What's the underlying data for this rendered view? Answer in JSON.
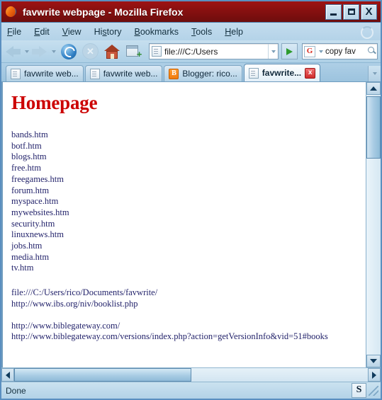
{
  "window": {
    "title": "favwrite webpage - Mozilla Firefox",
    "minimize_label": "Minimize",
    "maximize_label": "Maximize",
    "close_label": "X"
  },
  "menubar": {
    "items": [
      {
        "label": "File",
        "accesskey": "F"
      },
      {
        "label": "Edit",
        "accesskey": "E"
      },
      {
        "label": "View",
        "accesskey": "V"
      },
      {
        "label": "History",
        "accesskey": "s"
      },
      {
        "label": "Bookmarks",
        "accesskey": "B"
      },
      {
        "label": "Tools",
        "accesskey": "T"
      },
      {
        "label": "Help",
        "accesskey": "H"
      }
    ]
  },
  "toolbar": {
    "back_label": "Back",
    "forward_label": "Forward",
    "reload_label": "Reload",
    "stop_label": "Stop",
    "home_label": "Home",
    "newtab_label": "New Tab",
    "address_value": "file:///C:/Users",
    "go_label": "Go",
    "search_engine": "G",
    "search_value": "copy fav",
    "search_label": "Search"
  },
  "tabs": [
    {
      "label": "favwrite web...",
      "icon": "page-icon",
      "active": false
    },
    {
      "label": "favwrite web...",
      "icon": "page-icon",
      "active": false
    },
    {
      "label": "Blogger: rico...",
      "icon": "blogger-icon",
      "active": false
    },
    {
      "label": "favwrite...",
      "icon": "page-icon",
      "active": true,
      "close": "x"
    }
  ],
  "page": {
    "heading": "Homepage",
    "heading_color": "#cc0000",
    "files": [
      "bands.htm",
      "botf.htm",
      "blogs.htm",
      "free.htm",
      "freegames.htm",
      "forum.htm",
      "myspace.htm",
      "mywebsites.htm",
      "security.htm",
      "linuxnews.htm",
      "jobs.htm",
      "media.htm",
      "tv.htm"
    ],
    "urls_group_one": [
      "file:///C:/Users/rico/Documents/favwrite/",
      "http://www.ibs.org/niv/booklist.php"
    ],
    "urls_group_two": [
      "http://www.biblegateway.com/",
      "http://www.biblegateway.com/versions/index.php?action=getVersionInfo&vid=51#books"
    ],
    "link_color": "#23236b"
  },
  "statusbar": {
    "status": "Done",
    "secure_icon_label": "S"
  }
}
